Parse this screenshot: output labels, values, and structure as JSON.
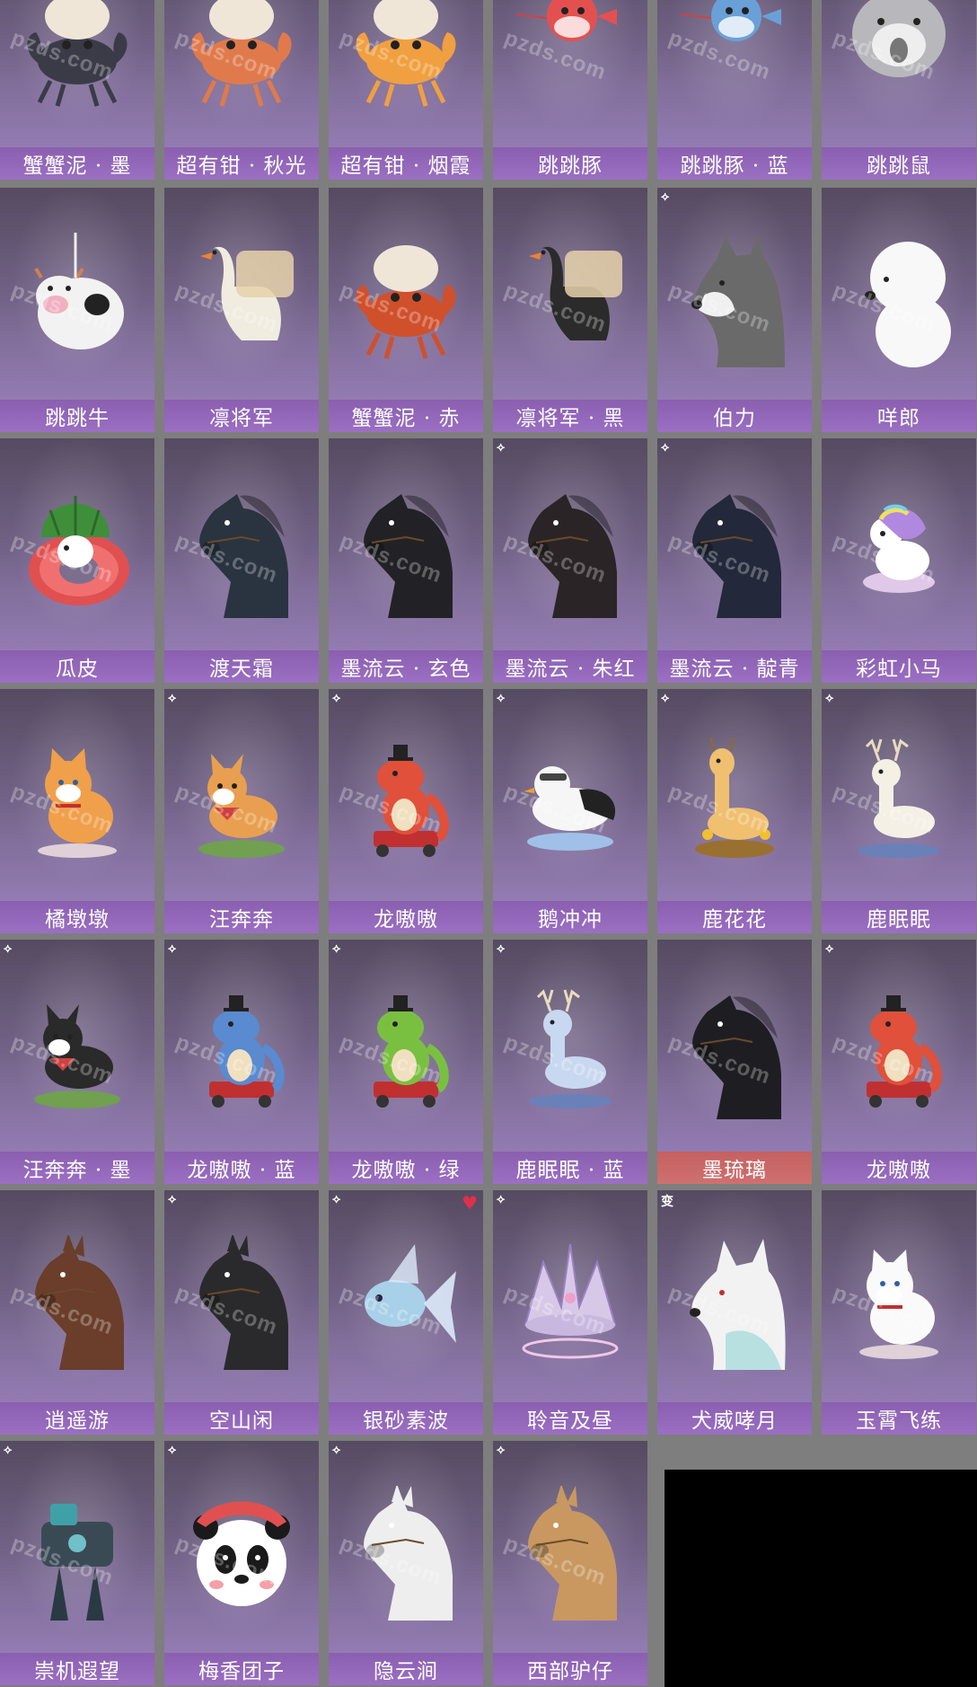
{
  "watermark": "pzds.com",
  "corner_badge": "ꀀ",
  "badge_text": "变",
  "items": [
    {
      "label": "蟹蟹泥 · 墨",
      "icon": "crab-icon",
      "tint": "#3b3b48"
    },
    {
      "label": "超有钳 · 秋光",
      "icon": "crab-icon",
      "tint": "#e07a4c"
    },
    {
      "label": "超有钳 · 烟霞",
      "icon": "crab-icon",
      "tint": "#f0a040"
    },
    {
      "label": "跳跳豚",
      "icon": "pufferfish-icon",
      "tint": "#e45050"
    },
    {
      "label": "跳跳豚 · 蓝",
      "icon": "pufferfish-icon",
      "tint": "#6aa0d8"
    },
    {
      "label": "跳跳鼠",
      "icon": "hamster-icon",
      "tint": "#b8b8bc"
    },
    {
      "label": "跳跳牛",
      "icon": "cow-icon",
      "tint": "#f2f2f2"
    },
    {
      "label": "凛将军",
      "icon": "goose-icon",
      "tint": "#f0ece0"
    },
    {
      "label": "蟹蟹泥 · 赤",
      "icon": "crab-icon",
      "tint": "#d0502c"
    },
    {
      "label": "凛将军 · 黑",
      "icon": "goose-icon",
      "tint": "#2b2b2b"
    },
    {
      "label": "伯力",
      "icon": "husky-icon",
      "tint": "#6a6a6a"
    },
    {
      "label": "咩郎",
      "icon": "poodle-icon",
      "tint": "#f8f8f8"
    },
    {
      "label": "瓜皮",
      "icon": "watermelon-icon",
      "tint": "#3f8f3a"
    },
    {
      "label": "渡天霜",
      "icon": "horse-icon",
      "tint": "#2a3340"
    },
    {
      "label": "墨流云 · 玄色",
      "icon": "horse-icon",
      "tint": "#222226"
    },
    {
      "label": "墨流云 · 朱红",
      "icon": "horse-icon",
      "tint": "#2a2426"
    },
    {
      "label": "墨流云 · 靛青",
      "icon": "horse-icon",
      "tint": "#23283a"
    },
    {
      "label": "彩虹小马",
      "icon": "unicorn-icon",
      "tint": "#f3c8e8"
    },
    {
      "label": "橘墩墩",
      "icon": "cat-icon",
      "tint": "#f0a04a"
    },
    {
      "label": "汪奔奔",
      "icon": "corgi-icon",
      "tint": "#e8a050"
    },
    {
      "label": "龙嗷嗷",
      "icon": "dino-icon",
      "tint": "#e0503a"
    },
    {
      "label": "鹅冲冲",
      "icon": "penguin-icon",
      "tint": "#f0f0f0"
    },
    {
      "label": "鹿花花",
      "icon": "giraffe-icon",
      "tint": "#f0c070"
    },
    {
      "label": "鹿眠眠",
      "icon": "deer-icon",
      "tint": "#f4f0e6"
    },
    {
      "label": "汪奔奔 · 墨",
      "icon": "corgi-icon",
      "tint": "#2a2a2a"
    },
    {
      "label": "龙嗷嗷 · 蓝",
      "icon": "dino-icon",
      "tint": "#5a8ad0"
    },
    {
      "label": "龙嗷嗷 · 绿",
      "icon": "dino-icon",
      "tint": "#7ac040"
    },
    {
      "label": "鹿眠眠 · 蓝",
      "icon": "deer-icon",
      "tint": "#c8d8f0"
    },
    {
      "label": "墨琉璃",
      "icon": "horse-icon",
      "tint": "#1e1e22",
      "red": true
    },
    {
      "label": "龙嗷嗷",
      "icon": "dino-icon",
      "tint": "#e0503a"
    },
    {
      "label": "逍遥游",
      "icon": "donkey-icon",
      "tint": "#6a3e2a"
    },
    {
      "label": "空山闲",
      "icon": "donkey-icon",
      "tint": "#2a2a2c"
    },
    {
      "label": "银砂素波",
      "icon": "fish-icon",
      "tint": "#a8d0e8"
    },
    {
      "label": "聆音及昼",
      "icon": "crown-icon",
      "tint": "#d8c8e8"
    },
    {
      "label": "犬威哮月",
      "icon": "wolf-icon",
      "tint": "#f2f2f2"
    },
    {
      "label": "玉霄飞练",
      "icon": "cat-icon",
      "tint": "#fafafa"
    },
    {
      "label": "崇机遐望",
      "icon": "mech-icon",
      "tint": "#3a4a55"
    },
    {
      "label": "梅香团子",
      "icon": "panda-icon",
      "tint": "#1a1a1a"
    },
    {
      "label": "隐云涧",
      "icon": "donkey-icon",
      "tint": "#eeeeee"
    },
    {
      "label": "西部驴仔",
      "icon": "donkey-icon",
      "tint": "#c89860"
    }
  ]
}
